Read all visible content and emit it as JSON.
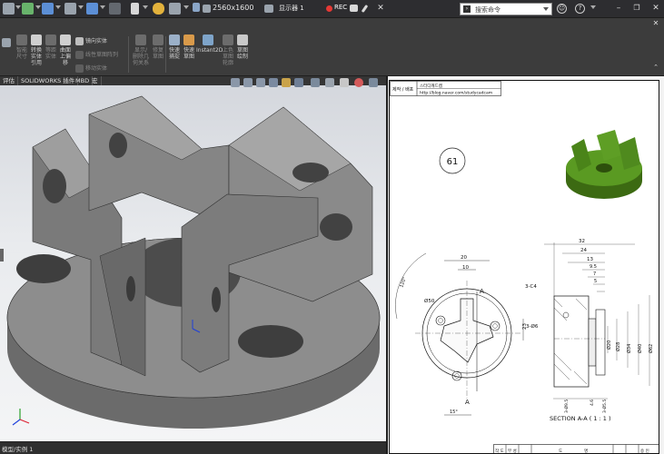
{
  "topbar": {
    "screen_resolution": "2560x1600",
    "display_label": "显示器 1",
    "rec_label": "REC",
    "search_placeholder": "搜索命令"
  },
  "ribbon": {
    "buttons": [
      {
        "label": "智能\n尺寸",
        "icon": "smart-dimension-icon",
        "enabled": false
      },
      {
        "label": "转换\n实体\n引用",
        "icon": "convert-entities-icon",
        "enabled": true
      },
      {
        "label": "等距\n实体",
        "icon": "offset-entities-icon",
        "enabled": false
      },
      {
        "label": "曲面\n上偏\n移",
        "icon": "offset-on-surface-icon",
        "enabled": true
      },
      {
        "label": "镜向实体",
        "icon": "mirror-entities-icon",
        "enabled": true
      },
      {
        "label": "线性草图阵列",
        "icon": "linear-pattern-icon",
        "enabled": false
      },
      {
        "label": "移动实体",
        "icon": "move-entities-icon",
        "enabled": false
      },
      {
        "label": "显示/\n删除几\n何关系",
        "icon": "display-relations-icon",
        "enabled": false
      },
      {
        "label": "修复\n草图",
        "icon": "repair-sketch-icon",
        "enabled": false
      },
      {
        "label": "快速\n捕捉",
        "icon": "quick-snaps-icon",
        "enabled": true
      },
      {
        "label": "快速\n草图",
        "icon": "rapid-sketch-icon",
        "enabled": true
      },
      {
        "label": "Instant2D",
        "icon": "instant2d-icon",
        "enabled": true
      },
      {
        "label": "上色\n草图\n轮廓",
        "icon": "shaded-sketch-contours-icon",
        "enabled": false
      },
      {
        "label": "草图\n绘制",
        "icon": "sketch-icon",
        "enabled": true
      }
    ]
  },
  "tabs": [
    "评估",
    "SOLIDWORKS 插件",
    "MBD",
    "宏"
  ],
  "status_bar": {
    "text": "模型/实例 1"
  },
  "colors": {
    "part_face_dark": "#707070",
    "part_face_mid": "#8e8e8e",
    "part_face_light": "#a8a8a8",
    "iso_preview": "#4f8a1e"
  },
  "drawing": {
    "titleblock": {
      "label": "제작 / 배포",
      "brand": "스터디캐드캠",
      "url": "http://blog.naver.com/studycadcam"
    },
    "problem_number": "61",
    "section_label": "SECTION A-A ( 1 : 1 )",
    "section_letter": "A",
    "dimensions": {
      "top_width": "20",
      "slot_width": "10",
      "radius": "Ø50",
      "angle": "120°",
      "bottom_angle": "15°",
      "height": "23",
      "hole": "3-Ø6",
      "chamfer": "3-C4",
      "d32": "32",
      "d24": "24",
      "d13": "13",
      "d9_5": "9.5",
      "d7": "7",
      "d5": "5",
      "d20": "Ø20",
      "d28": "Ø28",
      "d34": "Ø34",
      "d40": "Ø40",
      "d62": "Ø62",
      "bot1": "3-Ø9.5",
      "bot2": "4.6",
      "bot3": "3-Ø5.5"
    },
    "table_headers": [
      "작 도",
      "부 성",
      "도",
      "명",
      "승 인"
    ]
  }
}
